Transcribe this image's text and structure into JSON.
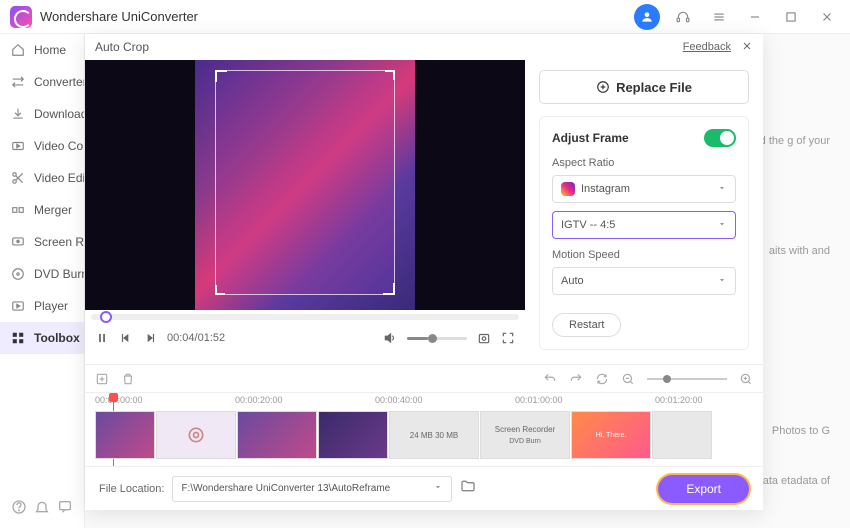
{
  "app": {
    "title": "Wondershare UniConverter"
  },
  "titlebar_icons": [
    "avatar",
    "headset",
    "menu",
    "minimize",
    "maximize",
    "close"
  ],
  "sidebar": {
    "items": [
      {
        "label": "Home",
        "icon": "home"
      },
      {
        "label": "Converter",
        "icon": "converter"
      },
      {
        "label": "Downloader",
        "icon": "download"
      },
      {
        "label": "Video Compressor",
        "icon": "compress"
      },
      {
        "label": "Video Editor",
        "icon": "scissors"
      },
      {
        "label": "Merger",
        "icon": "merge"
      },
      {
        "label": "Screen Recorder",
        "icon": "record"
      },
      {
        "label": "DVD Burner",
        "icon": "dvd"
      },
      {
        "label": "Player",
        "icon": "player"
      },
      {
        "label": "Toolbox",
        "icon": "grid",
        "active": true
      }
    ]
  },
  "bg_panel": {
    "snippets": [
      "d the\ng of your",
      "aits with\nand",
      "Photos to G",
      "data\netadata of"
    ]
  },
  "dialog": {
    "title": "Auto Crop",
    "feedback": "Feedback",
    "replace_label": "Replace File",
    "adjust_frame": "Adjust Frame",
    "aspect_ratio_label": "Aspect Ratio",
    "platform": "Instagram",
    "ratio": "IGTV -- 4:5",
    "motion_speed_label": "Motion Speed",
    "motion_speed": "Auto",
    "restart": "Restart",
    "time": "00:04/01:52",
    "timeline_ticks": [
      "00:00:00:00",
      "00:00:20:00",
      "00:00:40:00",
      "00:01:00:00",
      "00:01:20:00"
    ],
    "thumb_labels": [
      "",
      "",
      "",
      "",
      "24 MB   30 MB",
      "Screen Recorder",
      "Hi, There.",
      ""
    ],
    "file_location_label": "File Location:",
    "file_path": "F:\\Wondershare UniConverter 13\\AutoReframe",
    "export": "Export",
    "dvd_burn_label": "DVD Burn"
  }
}
